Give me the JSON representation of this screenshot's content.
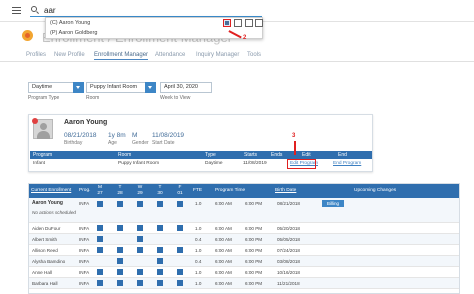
{
  "search": {
    "value": "aar"
  },
  "dropdown": {
    "items": [
      "(C) Aaron Young",
      "(P) Aaron Goldberg"
    ]
  },
  "annotations": {
    "step2": "2",
    "step3": "3"
  },
  "header": {
    "title": "Enrollment / Enrollment Manager"
  },
  "tabs": [
    "Profiles",
    "New Profile",
    "Enrollment Manager",
    "Attendance",
    "Inquiry Manager",
    "Tools"
  ],
  "filters": {
    "program_value": "Daytime",
    "program_label": "Program Type",
    "room_value": "Puppy Infant Room",
    "room_label": "Room",
    "week_value": "April 30, 2020",
    "week_label": "Week to View"
  },
  "child_card": {
    "name": "Aaron Young",
    "birthday": "08/21/2018",
    "birthday_label": "Birthday",
    "age": "1y 8m",
    "age_label": "Age",
    "gender": "M",
    "gender_label": "Gender",
    "start_date": "11/08/2019",
    "start_date_label": "Start Date",
    "columns": [
      "Program",
      "Room",
      "Type",
      "Starts",
      "Ends",
      "Edit",
      "End"
    ],
    "row": {
      "program": "Infant",
      "room": "Puppy Infant Room",
      "type": "Daytime",
      "starts": "11/08/2019",
      "ends": "",
      "edit": "Edit Program",
      "end": "End Program"
    }
  },
  "enrollment": {
    "columns": {
      "current": "Current Enrollment",
      "prog": "Prog.",
      "days": [
        {
          "d": "M",
          "date": "27"
        },
        {
          "d": "T",
          "date": "28"
        },
        {
          "d": "W",
          "date": "29"
        },
        {
          "d": "T",
          "date": "30"
        },
        {
          "d": "F",
          "date": "01"
        }
      ],
      "fte": "FTE",
      "program_time": "Program Time",
      "birth_date": "Birth Date",
      "upcoming": "Upcoming Changes"
    },
    "rows": [
      {
        "name": "Aaron Young",
        "prog": "INFA",
        "fte": "1.0",
        "start": "6:00 AM",
        "end": "6:00 PM",
        "birth": "08/21/2018",
        "action": "Billing",
        "note": "No actions scheduled"
      },
      {
        "name": "Aiden DuFour",
        "prog": "INFA",
        "fte": "1.0",
        "start": "6:00 AM",
        "end": "6:00 PM",
        "birth": "05/20/2018"
      },
      {
        "name": "Albert Smith",
        "prog": "INFA",
        "fte": "0.4",
        "start": "6:00 AM",
        "end": "6:00 PM",
        "birth": "05/05/2018"
      },
      {
        "name": "Allison Reed",
        "prog": "INFA",
        "fte": "1.0",
        "start": "6:00 AM",
        "end": "6:00 PM",
        "birth": "07/24/2018"
      },
      {
        "name": "Alysha Bamdino",
        "prog": "INFA",
        "fte": "0.4",
        "start": "6:00 AM",
        "end": "6:00 PM",
        "birth": "03/08/2018"
      },
      {
        "name": "Anne Hall",
        "prog": "INFA",
        "fte": "1.0",
        "start": "6:00 AM",
        "end": "6:00 PM",
        "birth": "10/16/2018"
      },
      {
        "name": "Barbara Hall",
        "prog": "INFA",
        "fte": "1.0",
        "start": "6:00 AM",
        "end": "6:00 PM",
        "birth": "11/21/2018"
      }
    ]
  },
  "colors": {
    "primary": "#2f6eae",
    "accent": "#3d86c6",
    "annotation": "#e02020"
  }
}
